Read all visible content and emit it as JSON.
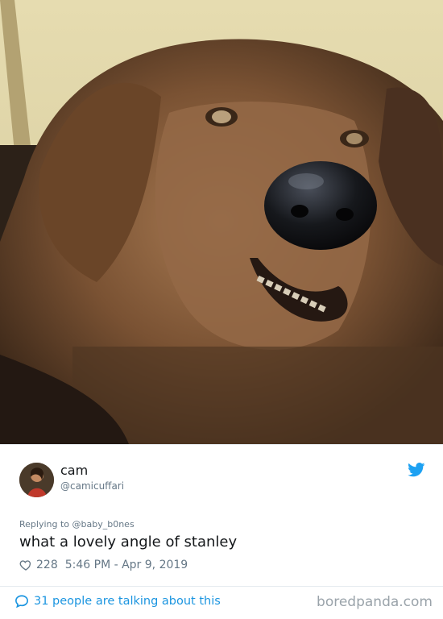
{
  "photo": {
    "description_icon": "dog-photo"
  },
  "tweet": {
    "name": "cam",
    "handle": "@camicuffari",
    "replying_prefix": "Replying to",
    "replying_to": "@baby_b0nes",
    "text": "what a lovely angle of stanley",
    "likes": "228",
    "timestamp": "5:46 PM - Apr 9, 2019",
    "talking": "31 people are talking about this"
  },
  "watermark": "boredpanda.com",
  "colors": {
    "twitter_blue": "#1da1f2",
    "link_blue": "#1b95e0",
    "muted": "#657786"
  },
  "icons": {
    "brand": "twitter-bird-icon",
    "like": "heart-icon",
    "reply": "speech-bubble-icon"
  }
}
